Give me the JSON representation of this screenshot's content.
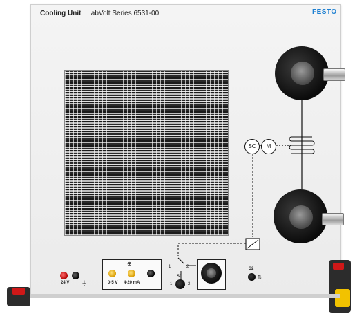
{
  "header": {
    "title_bold": "Cooling Unit",
    "title_series": "LabVolt Series 6531-00",
    "brand": "FESTO"
  },
  "diagram": {
    "sc_label": "SC",
    "motor_label": "M"
  },
  "power": {
    "voltage_label": "24 V"
  },
  "signal": {
    "range_v": "0-5 V",
    "range_ma": "4-20 mA"
  },
  "switch_s1": {
    "label": "S1",
    "pos1": "1",
    "pos2": "2"
  },
  "switch_s2": {
    "label": "S2"
  },
  "selector_top": {
    "pos1": "1",
    "pos2": "2"
  }
}
